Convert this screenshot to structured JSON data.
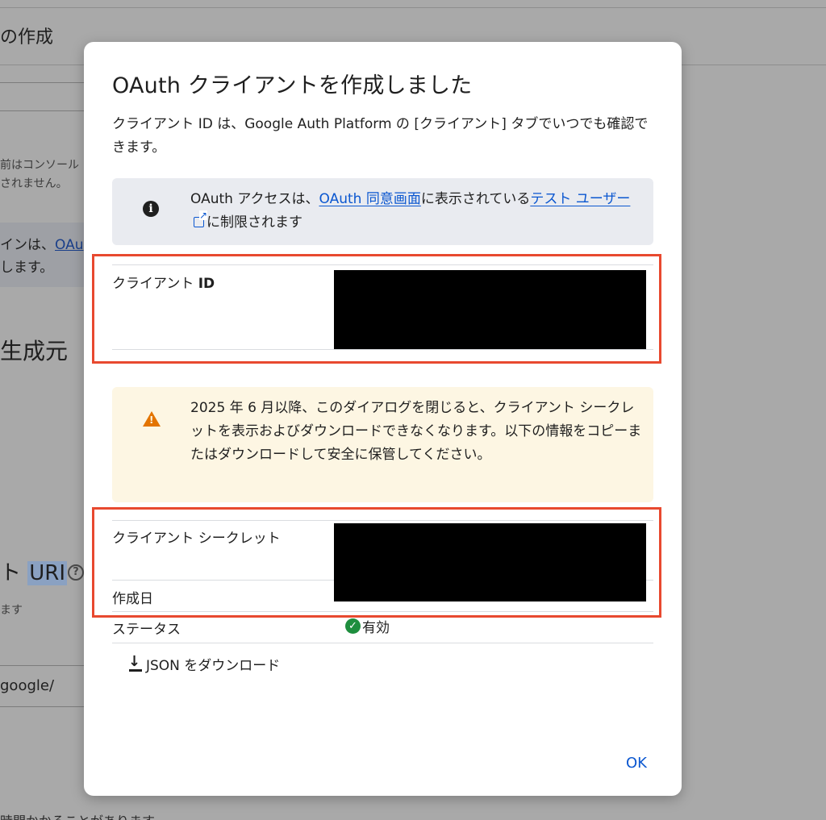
{
  "background": {
    "page_title": "の作成",
    "help_text_line1": "前はコンソール",
    "help_text_line2": "されません。",
    "info_line1_prefix": "インは、",
    "info_line1_link": "OAu",
    "info_line2": "します。",
    "section1_title": "生成元",
    "section2_title_prefix": "ト ",
    "section2_title_hl": "URI",
    "section2_help_icon": "?",
    "section2_small": "ます",
    "input_value": "google/",
    "bottom_text": "時間かかることがあります"
  },
  "dialog": {
    "title": "OAuth クライアントを作成しました",
    "subtitle": "クライアント ID は、Google Auth Platform の [クライアント] タブでいつでも確認できます。",
    "info": {
      "icon": "info-icon",
      "text_before": "OAuth アクセスは、",
      "link1": "OAuth 同意画面",
      "text_middle": "に表示されている",
      "link2": "テスト ユーザー",
      "text_after": "に制限されます"
    },
    "client_id_label_prefix": "クライアント ",
    "client_id_label_bold": "ID",
    "warning": {
      "icon": "warning-icon",
      "text": "2025 年 6 月以降、このダイアログを閉じると、クライアント シークレットを表示およびダウンロードできなくなります。以下の情報をコピーまたはダウンロードして安全に保管してください。"
    },
    "client_secret_label": "クライアント シークレット",
    "created_label": "作成日",
    "status_label": "ステータス",
    "status_value": "有効",
    "download_label": "JSON をダウンロード",
    "ok_label": "OK"
  },
  "colors": {
    "link": "#0b57d0",
    "warning": "#e37400",
    "success": "#1e8e3e",
    "highlight_box": "#e8492f"
  }
}
